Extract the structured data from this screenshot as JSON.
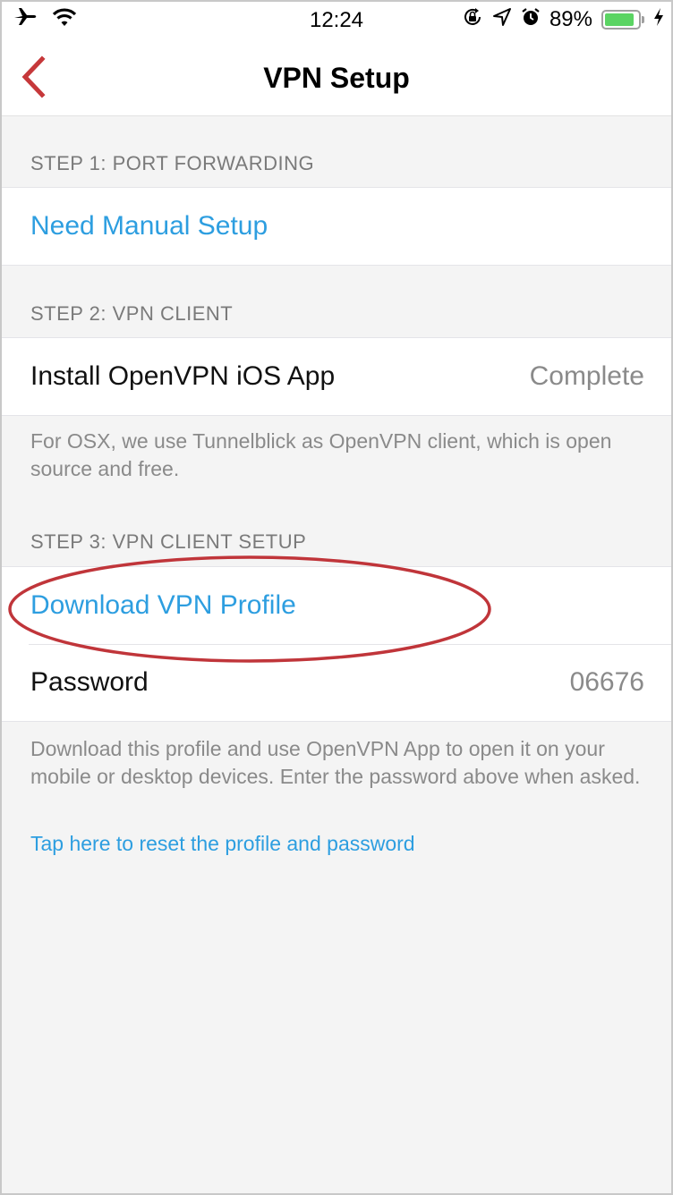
{
  "status_bar": {
    "time": "12:24",
    "battery_percent_text": "89%",
    "battery_level": 0.89,
    "battery_color": "#5bd463",
    "icons_left": [
      "airplane-icon",
      "wifi-icon"
    ],
    "icons_right": [
      "rotation-lock-icon",
      "location-arrow-icon",
      "alarm-icon",
      "battery-icon",
      "charging-bolt-icon"
    ]
  },
  "nav": {
    "title": "VPN Setup",
    "back_icon": "chevron-left-icon",
    "accent_color": "#c6383a"
  },
  "sections": [
    {
      "header": "STEP 1: PORT FORWARDING",
      "cells": [
        {
          "label": "Need Manual Setup",
          "type": "link"
        }
      ]
    },
    {
      "header": "STEP 2: VPN CLIENT",
      "cells": [
        {
          "label": "Install OpenVPN iOS App",
          "value": "Complete"
        }
      ],
      "footer": "For OSX, we use Tunnelblick as OpenVPN client, which is open source and free."
    },
    {
      "header": "STEP 3: VPN CLIENT SETUP",
      "cells": [
        {
          "label": "Download VPN Profile",
          "type": "link",
          "highlighted": true
        },
        {
          "label": "Password",
          "value": "06676"
        }
      ],
      "footer": "Download this profile and use OpenVPN App to open it on your mobile or desktop devices. Enter the password above when asked.",
      "footer_link": "Tap here to reset the profile and password"
    }
  ],
  "colors": {
    "link": "#2d9ee0",
    "annotation": "#c0353a",
    "background": "#f4f4f4"
  }
}
